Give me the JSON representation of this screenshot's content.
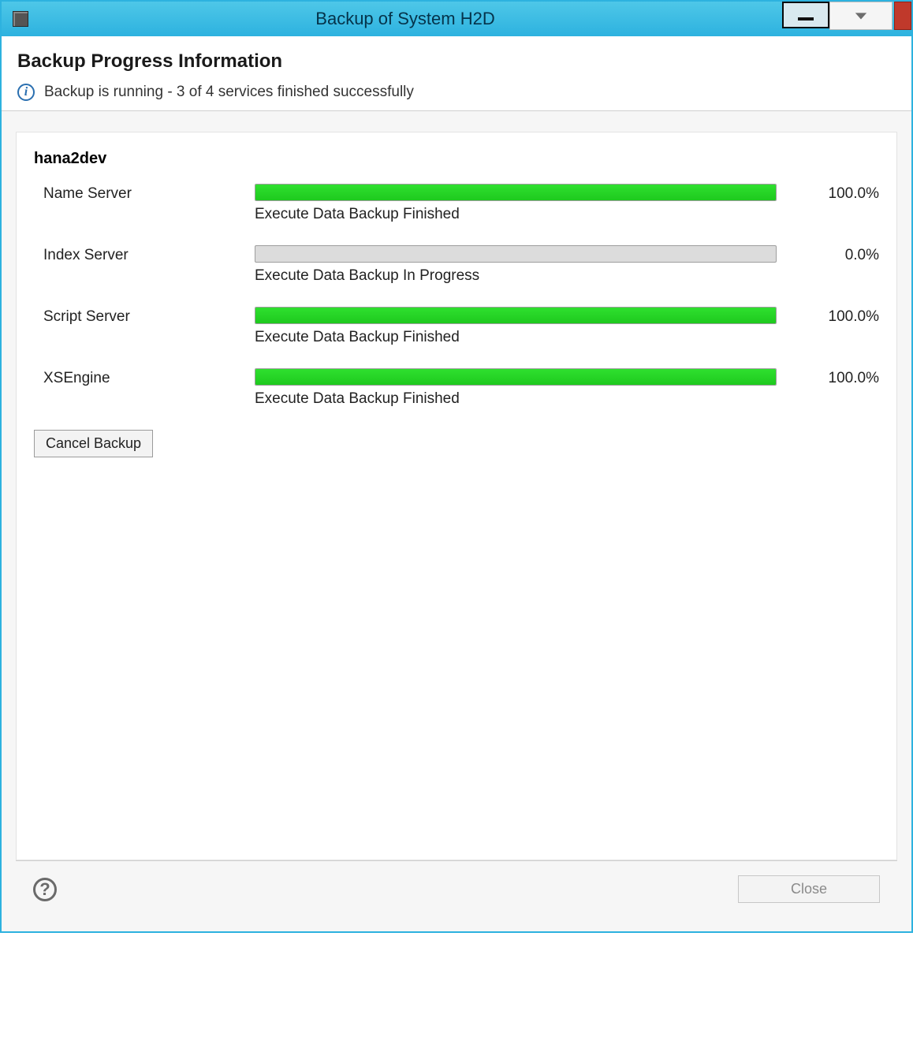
{
  "window": {
    "title": "Backup of System H2D"
  },
  "header": {
    "title": "Backup Progress Information",
    "status": "Backup is running - 3 of 4 services finished successfully"
  },
  "host": "hana2dev",
  "services": [
    {
      "name": "Name Server",
      "percent": 100.0,
      "percent_label": "100.0%",
      "status": "Execute Data Backup Finished",
      "fill_color": "#1ec91e"
    },
    {
      "name": "Index Server",
      "percent": 0.0,
      "percent_label": "0.0%",
      "status": "Execute Data Backup In Progress",
      "fill_color": "#1ec91e"
    },
    {
      "name": "Script Server",
      "percent": 100.0,
      "percent_label": "100.0%",
      "status": "Execute Data Backup Finished",
      "fill_color": "#1ec91e"
    },
    {
      "name": "XSEngine",
      "percent": 100.0,
      "percent_label": "100.0%",
      "status": "Execute Data Backup Finished",
      "fill_color": "#1ec91e"
    }
  ],
  "buttons": {
    "cancel": "Cancel Backup",
    "close": "Close"
  }
}
